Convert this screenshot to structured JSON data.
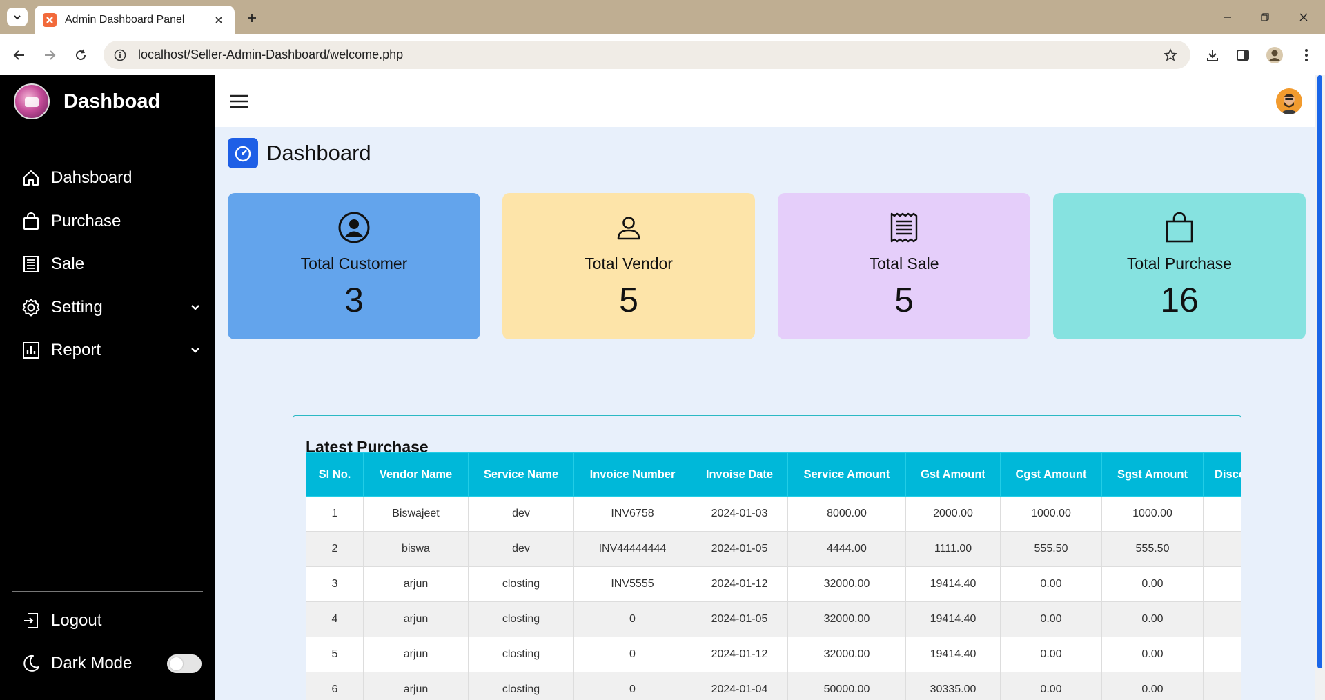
{
  "browser": {
    "tab_title": "Admin Dashboard Panel",
    "url": "localhost/Seller-Admin-Dashboard/welcome.php"
  },
  "sidebar": {
    "brand": "Dashboad",
    "items": [
      {
        "label": "Dahsboard",
        "icon": "home-icon"
      },
      {
        "label": "Purchase",
        "icon": "shopping-bag-icon"
      },
      {
        "label": "Sale",
        "icon": "receipt-icon"
      },
      {
        "label": "Setting",
        "icon": "gear-icon",
        "has_submenu": true
      },
      {
        "label": "Report",
        "icon": "bar-chart-icon",
        "has_submenu": true
      }
    ],
    "logout_label": "Logout",
    "dark_mode_label": "Dark Mode",
    "dark_mode_on": false
  },
  "main": {
    "page_title": "Dashboard",
    "cards": [
      {
        "label": "Total Customer",
        "value": "3",
        "icon": "user-circle-icon",
        "color": "#63a4ec"
      },
      {
        "label": "Total Vendor",
        "value": "5",
        "icon": "person-icon",
        "color": "#fde4a9"
      },
      {
        "label": "Total Sale",
        "value": "5",
        "icon": "receipt-icon",
        "color": "#e5cefa"
      },
      {
        "label": "Total Purchase",
        "value": "16",
        "icon": "shopping-bag-icon",
        "color": "#86e2e0"
      }
    ],
    "latest_purchase": {
      "title": "Latest Purchase",
      "columns": [
        "Sl No.",
        "Vendor Name",
        "Service Name",
        "Invoice Number",
        "Invoise Date",
        "Service Amount",
        "Gst Amount",
        "Cgst Amount",
        "Sgst Amount",
        "Discount"
      ],
      "rows": [
        [
          "1",
          "Biswajeet",
          "dev",
          "INV6758",
          "2024-01-03",
          "8000.00",
          "2000.00",
          "1000.00",
          "1000.00",
          ""
        ],
        [
          "2",
          "biswa",
          "dev",
          "INV44444444",
          "2024-01-05",
          "4444.00",
          "1111.00",
          "555.50",
          "555.50",
          ""
        ],
        [
          "3",
          "arjun",
          "closting",
          "INV5555",
          "2024-01-12",
          "32000.00",
          "19414.40",
          "0.00",
          "0.00",
          ""
        ],
        [
          "4",
          "arjun",
          "closting",
          "0",
          "2024-01-05",
          "32000.00",
          "19414.40",
          "0.00",
          "0.00",
          ""
        ],
        [
          "5",
          "arjun",
          "closting",
          "0",
          "2024-01-12",
          "32000.00",
          "19414.40",
          "0.00",
          "0.00",
          ""
        ],
        [
          "6",
          "arjun",
          "closting",
          "0",
          "2024-01-04",
          "50000.00",
          "30335.00",
          "0.00",
          "0.00",
          ""
        ]
      ]
    }
  },
  "colors": {
    "sidebar_bg": "#000000",
    "main_bg": "#e8f0fb",
    "table_header": "#00b8d9",
    "accent_blue": "#1e5fe6"
  }
}
